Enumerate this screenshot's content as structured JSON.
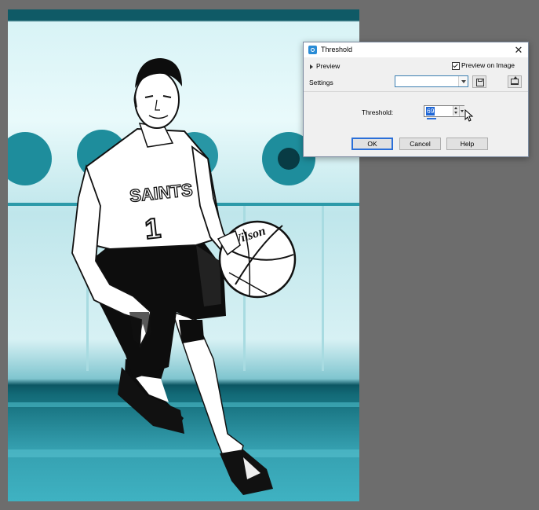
{
  "dialog": {
    "title": "Threshold",
    "close_label": "✕",
    "preview_label": "Preview",
    "preview_on_image_label": "Preview on Image",
    "preview_on_image_checked": true,
    "settings_label": "Settings",
    "settings_value": "",
    "threshold_label": "Threshold:",
    "threshold_value": "69",
    "buttons": {
      "ok": "OK",
      "cancel": "Cancel",
      "help": "Help"
    }
  },
  "photo": {
    "jersey_text": "SAINTS",
    "jersey_number": "1",
    "ball_text": "Wilson"
  },
  "colors": {
    "teal": "#1b8a98",
    "dark_teal": "#0c5663",
    "background": "#6d6d6d",
    "accent": "#2b6fd8"
  },
  "icons": [
    "app-icon",
    "close-icon",
    "expand-triangle-icon",
    "checkbox-icon",
    "save-preset-icon",
    "reset-default-icon",
    "spin-up-icon",
    "spin-down-icon",
    "mouse-cursor-icon"
  ]
}
